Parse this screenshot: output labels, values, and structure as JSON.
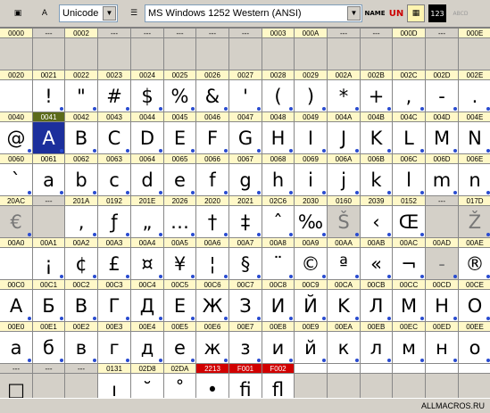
{
  "toolbar": {
    "font_mode": "Unicode",
    "encoding": "MS Windows 1252 Western (ANSI)",
    "btn_name": "NAME",
    "btn_un": "UN",
    "btn_123": "123",
    "btn_abcd": "ABCD"
  },
  "status": {
    "watermark": "ALLMACROS.RU"
  },
  "colors": {
    "code_yellow": "#fff8c8",
    "code_grey": "#d4d0c8",
    "empty_cell": "#d4d0c8",
    "selected": "#1c2f9c",
    "hot_code": "#d10000"
  },
  "rows": [
    {
      "codes": [
        "0000",
        "---",
        "0002",
        "---",
        "---",
        "---",
        "---",
        "---",
        "0003",
        "000A",
        "---",
        "---",
        "000D",
        "---"
      ],
      "glyphs": [
        "",
        "",
        "",
        "",
        "",
        "",
        "",
        "",
        "",
        "",
        "",
        "",
        "",
        ""
      ]
    },
    {
      "codes": [
        "0020",
        "0021",
        "0022",
        "0023",
        "0024",
        "0025",
        "0026",
        "0027",
        "0028",
        "0029",
        "002A",
        "002B",
        "002C",
        "002D"
      ],
      "glyphs": [
        "",
        "!",
        "\"",
        "#",
        "$",
        "%",
        "&",
        "'",
        "(",
        ")",
        "*",
        "+",
        ",",
        "-"
      ]
    },
    {
      "codes": [
        "0040",
        "0041",
        "0042",
        "0043",
        "0044",
        "0045",
        "0046",
        "0047",
        "0048",
        "0049",
        "004A",
        "004B",
        "004C",
        "004D"
      ],
      "glyphs": [
        "@",
        "A",
        "B",
        "C",
        "D",
        "E",
        "F",
        "G",
        "H",
        "I",
        "J",
        "K",
        "L",
        "M"
      ]
    },
    {
      "codes": [
        "0060",
        "0061",
        "0062",
        "0063",
        "0064",
        "0065",
        "0066",
        "0067",
        "0068",
        "0069",
        "006A",
        "006B",
        "006C",
        "006D"
      ],
      "glyphs": [
        "`",
        "a",
        "b",
        "c",
        "d",
        "e",
        "f",
        "g",
        "h",
        "i",
        "j",
        "k",
        "l",
        "m"
      ]
    },
    {
      "codes": [
        "20AC",
        "---",
        "201A",
        "0192",
        "201E",
        "2026",
        "2020",
        "2021",
        "02C6",
        "2030",
        "0160",
        "2039",
        "0152",
        "---"
      ],
      "glyphs": [
        "€",
        "",
        "‚",
        "ƒ",
        "„",
        "…",
        "†",
        "‡",
        "ˆ",
        "‰",
        "Š",
        "‹",
        "Œ",
        ""
      ]
    },
    {
      "codes": [
        "00A0",
        "00A1",
        "00A2",
        "00A3",
        "00A4",
        "00A5",
        "00A6",
        "00A7",
        "00A8",
        "00A9",
        "00AA",
        "00AB",
        "00AC",
        "00AD"
      ],
      "glyphs": [
        "",
        "¡",
        "¢",
        "£",
        "¤",
        "¥",
        "¦",
        "§",
        "¨",
        "©",
        "ª",
        "«",
        "¬",
        "-"
      ]
    },
    {
      "codes": [
        "00C0",
        "00C1",
        "00C2",
        "00C3",
        "00C4",
        "00C5",
        "00C6",
        "00C7",
        "00C8",
        "00C9",
        "00CA",
        "00CB",
        "00CC",
        "00CD"
      ],
      "glyphs": [
        "A",
        "Б",
        "B",
        "Г",
        "Д",
        "E",
        "Ж",
        "З",
        "И",
        "Й",
        "K",
        "Л",
        "M",
        "H"
      ]
    },
    {
      "codes": [
        "00E0",
        "00E1",
        "00E2",
        "00E3",
        "00E4",
        "00E5",
        "00E6",
        "00E7",
        "00E8",
        "00E9",
        "00EA",
        "00EB",
        "00EC",
        "00ED"
      ],
      "glyphs": [
        "a",
        "б",
        "в",
        "г",
        "д",
        "e",
        "ж",
        "з",
        "и",
        "й",
        "к",
        "л",
        "м",
        "н"
      ]
    },
    {
      "codes": [
        "---",
        "---",
        "---",
        "0131",
        "02D8",
        "02DA",
        "2213",
        "F001",
        "F002",
        "",
        "",
        "",
        "",
        ""
      ],
      "glyphs": [
        "□",
        "",
        "",
        "ı",
        "˘",
        "˚",
        "•",
        "fi",
        "fl",
        "",
        "",
        "",
        "",
        ""
      ]
    }
  ],
  "last_column": {
    "codes": [
      "000E",
      "002E",
      "004E",
      "006E",
      "017D",
      "00AE",
      "00CE",
      "00EE",
      ""
    ],
    "glyphs": [
      "",
      ".",
      "N",
      "n",
      "Ž",
      "®",
      "O",
      "o",
      ""
    ]
  },
  "selected_code": "0041"
}
